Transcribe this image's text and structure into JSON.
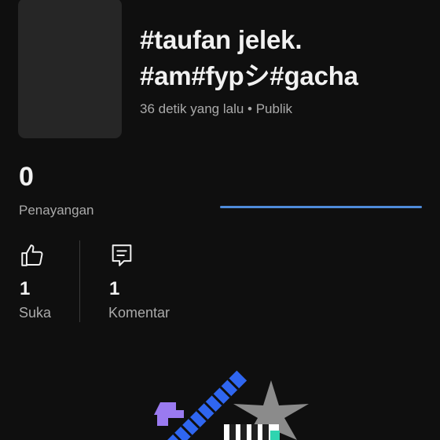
{
  "video": {
    "title_line1": "#taufan jelek.",
    "title_line2": "#am#fypシ#gacha",
    "meta": "36 detik yang lalu • Publik"
  },
  "views": {
    "count": "0",
    "label": "Penayangan"
  },
  "likes": {
    "icon": "thumbs-up-icon",
    "count": "1",
    "label": "Suka"
  },
  "comments": {
    "icon": "comment-icon",
    "count": "1",
    "label": "Komentar"
  },
  "colors": {
    "background": "#0f0f0f",
    "accent_line": "#4f8bd9",
    "secondary_text": "#aaaaaa"
  }
}
